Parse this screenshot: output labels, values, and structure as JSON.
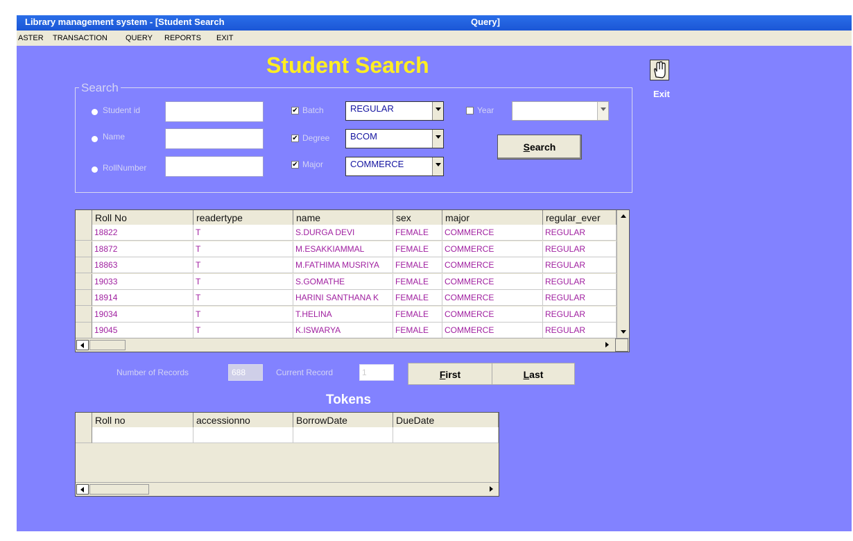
{
  "window": {
    "title_left": "Library management system - [Student Search",
    "title_right": "Query]"
  },
  "menu": [
    "ASTER",
    "TRANSACTION",
    "QUERY",
    "REPORTS",
    "EXIT"
  ],
  "page_title": "Student Search",
  "exit_label": "Exit",
  "search": {
    "group_label": "Search",
    "student_id_label": "Student id",
    "name_label": "Name",
    "rollnumber_label": "RollNumber",
    "student_id_value": "",
    "name_value": "",
    "rollnumber_value": "",
    "batch_label": "Batch",
    "batch_value": "REGULAR",
    "batch_checked": true,
    "degree_label": "Degree",
    "degree_value": "BCOM",
    "degree_checked": true,
    "major_label": "Major",
    "major_value": "COMMERCE",
    "major_checked": true,
    "year_label": "Year",
    "year_value": "",
    "year_checked": false,
    "search_button_prefix": "S",
    "search_button_rest": "earch"
  },
  "results": {
    "columns": [
      "Roll No",
      "readertype",
      "name",
      "sex",
      "major",
      "regular_ever"
    ],
    "rows": [
      [
        "18822",
        "T",
        "S.DURGA DEVI",
        "FEMALE",
        "COMMERCE",
        "REGULAR"
      ],
      [
        "18872",
        "T",
        "M.ESAKKIAMMAL",
        "FEMALE",
        "COMMERCE",
        "REGULAR"
      ],
      [
        "18863",
        "T",
        "M.FATHIMA MUSRIYA",
        "FEMALE",
        "COMMERCE",
        "REGULAR"
      ],
      [
        "19033",
        "T",
        "S.GOMATHE",
        "FEMALE",
        "COMMERCE",
        "REGULAR"
      ],
      [
        "18914",
        "T",
        "HARINI SANTHANA K",
        "FEMALE",
        "COMMERCE",
        "REGULAR"
      ],
      [
        "19034",
        "T",
        "T.HELINA",
        "FEMALE",
        "COMMERCE",
        "REGULAR"
      ],
      [
        "19045",
        "T",
        "K.ISWARYA",
        "FEMALE",
        "COMMERCE",
        "REGULAR"
      ]
    ]
  },
  "nav": {
    "num_records_label": "Number of Records",
    "num_records_value": "688",
    "current_record_label": "Current Record",
    "current_record_value": "1",
    "first_prefix": "F",
    "first_rest": "irst",
    "last_prefix": "L",
    "last_rest": "ast"
  },
  "tokens": {
    "title": "Tokens",
    "columns": [
      "Roll no",
      "accessionno",
      "BorrowDate",
      "DueDate"
    ]
  },
  "colors": {
    "client_bg": "#8282ff",
    "title_yellow": "#ffee22",
    "cell_text": "#a020a0"
  }
}
